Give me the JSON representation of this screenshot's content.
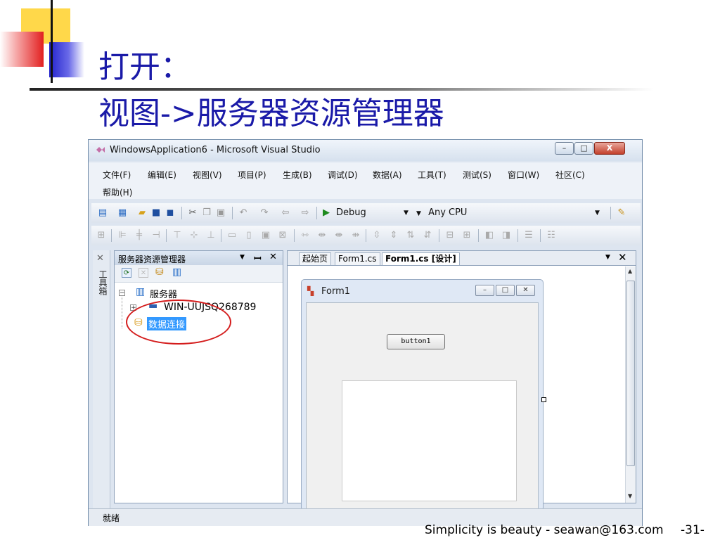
{
  "slide": {
    "title_line1": "打开：",
    "title_line2": "视图->服务器资源管理器",
    "footer_text": "Simplicity is beauty - seawan@163.com",
    "page_number": "-31-"
  },
  "window": {
    "title": "WindowsApplication6 - Microsoft Visual Studio",
    "minimize": "–",
    "maximize": "□",
    "close": "X"
  },
  "menu": {
    "items": [
      "文件(F)",
      "编辑(E)",
      "视图(V)",
      "项目(P)",
      "生成(B)",
      "调试(D)",
      "数据(A)",
      "工具(T)",
      "测试(S)",
      "窗口(W)",
      "社区(C)"
    ],
    "second_row": [
      "帮助(H)"
    ]
  },
  "toolbar": {
    "config_value": "Debug",
    "platform_value": "Any CPU"
  },
  "side_strip": {
    "label": "工具箱"
  },
  "server_explorer": {
    "title": "服务器资源管理器",
    "dropdown_glyph": "▼",
    "pin_glyph": "ꟷ",
    "close_glyph": "✕",
    "servers_label": "服务器",
    "server_name": "WIN-UUJSQ268789",
    "data_connections_label": "数据连接"
  },
  "designer": {
    "tabs": [
      "起始页",
      "Form1.cs",
      "Form1.cs [设计]"
    ],
    "close_glyph": "✕",
    "dropdown_glyph": "▼",
    "form_title": "Form1",
    "button_text": "button1"
  },
  "status": {
    "text": "就绪"
  },
  "colors": {
    "title_blue": "#1a1aa8",
    "selection_blue": "#3399ff",
    "highlight_red": "#d41c1c"
  }
}
